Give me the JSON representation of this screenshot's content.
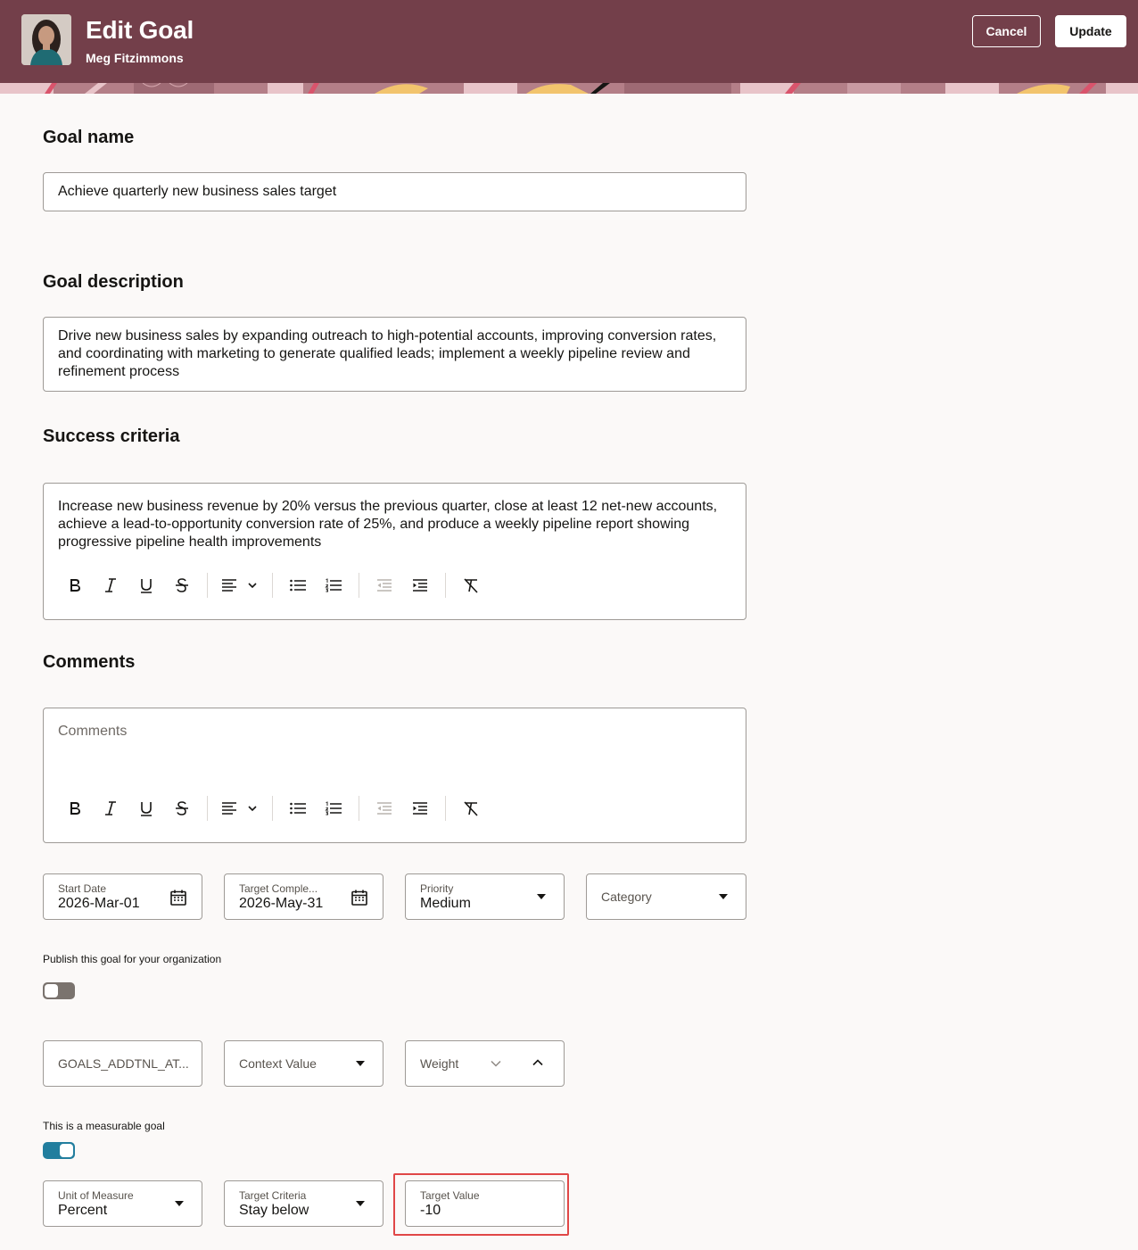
{
  "header": {
    "title": "Edit Goal",
    "subtitle": "Meg Fitzimmons",
    "cancel_label": "Cancel",
    "update_label": "Update",
    "background_color": "#733f4a"
  },
  "goal_name": {
    "heading": "Goal name",
    "value": "Achieve quarterly new business sales target"
  },
  "goal_description": {
    "heading": "Goal description",
    "value": "Drive new business sales by expanding outreach to high-potential accounts, improving conversion rates, and coordinating with marketing to generate qualified leads; implement a weekly pipeline review and refinement process"
  },
  "success_criteria": {
    "heading": "Success criteria",
    "value": "Increase new business revenue by 20% versus the previous quarter, close at least 12 net-new accounts, achieve a lead-to-opportunity conversion rate of 25%, and produce a weekly pipeline report showing progressive pipeline health improvements"
  },
  "comments": {
    "heading": "Comments",
    "placeholder": "Comments"
  },
  "dates": {
    "start_label": "Start Date",
    "start_value": "2026-Mar-01",
    "target_label": "Target Comple...",
    "target_value": "2026-May-31",
    "priority_label": "Priority",
    "priority_value": "Medium",
    "category_placeholder": "Category"
  },
  "publish": {
    "label": "Publish this goal for your organization",
    "enabled": false
  },
  "additional": {
    "attribute_placeholder": "GOALS_ADDTNL_AT...",
    "context_placeholder": "Context Value",
    "weight_placeholder": "Weight"
  },
  "measurable": {
    "label": "This is a measurable goal",
    "enabled": true,
    "unit_label": "Unit of Measure",
    "unit_value": "Percent",
    "criteria_label": "Target Criteria",
    "criteria_value": "Stay below",
    "target_value_label": "Target Value",
    "target_value": "-10"
  },
  "colors": {
    "accent_toggle": "#227e9e",
    "highlight": "#e04747"
  }
}
